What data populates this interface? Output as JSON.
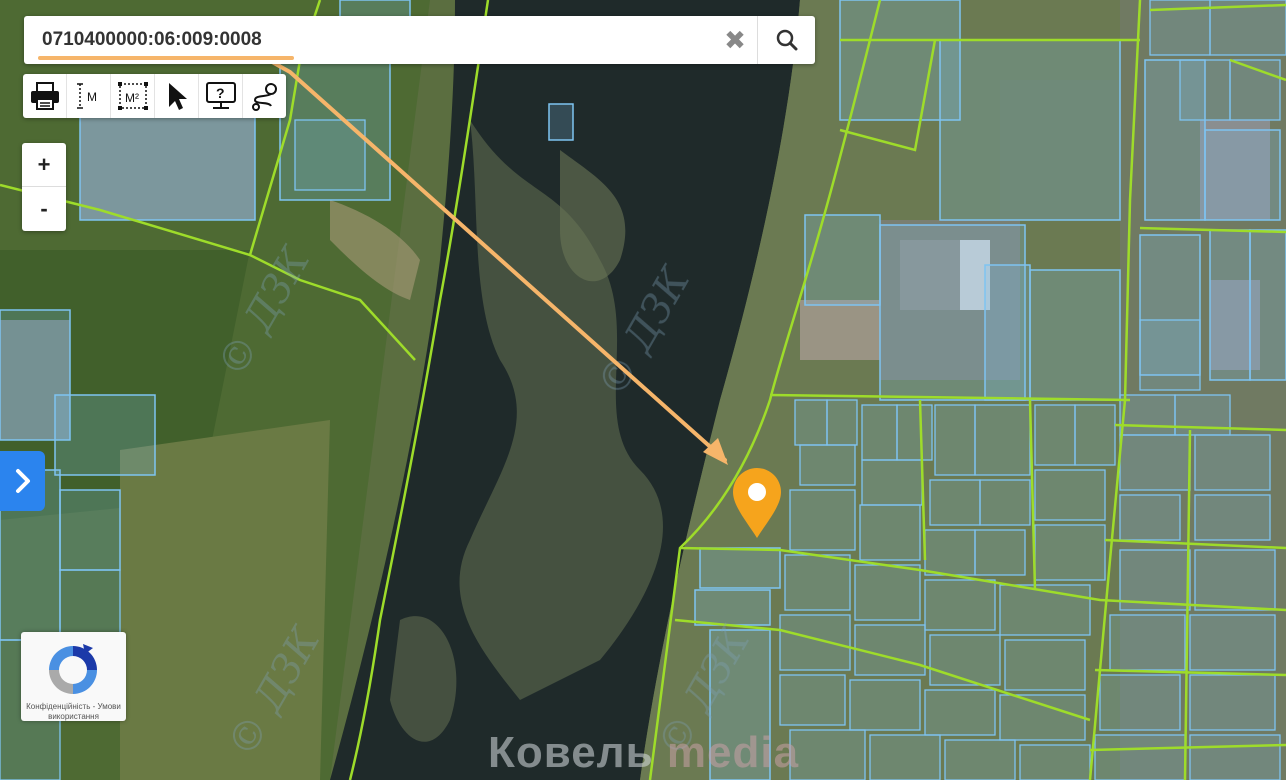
{
  "search": {
    "value": "0710400000:06:009:0008",
    "clear_icon": "close-icon",
    "submit_icon": "search-icon"
  },
  "toolbar": {
    "tools": [
      "print-icon",
      "measure-distance-icon",
      "measure-area-icon",
      "select-pointer-icon",
      "identify-help-icon",
      "route-icon"
    ],
    "measure_distance_label": "M",
    "measure_area_label": "M²"
  },
  "zoom": {
    "in_label": "+",
    "out_label": "-"
  },
  "side_panel": {
    "icon": "chevron-right-icon"
  },
  "recaptcha": {
    "text": "Конфіденційність - Умови використання"
  },
  "map": {
    "watermark_city": "Ковель",
    "watermark_brand": "media",
    "imagery_watermark": "© ДЗК",
    "marker_color": "#f6a41c",
    "parcel_color": "#7ec4f2",
    "boundary_color": "#9edc2a",
    "arrow_color": "#f6b56a"
  }
}
